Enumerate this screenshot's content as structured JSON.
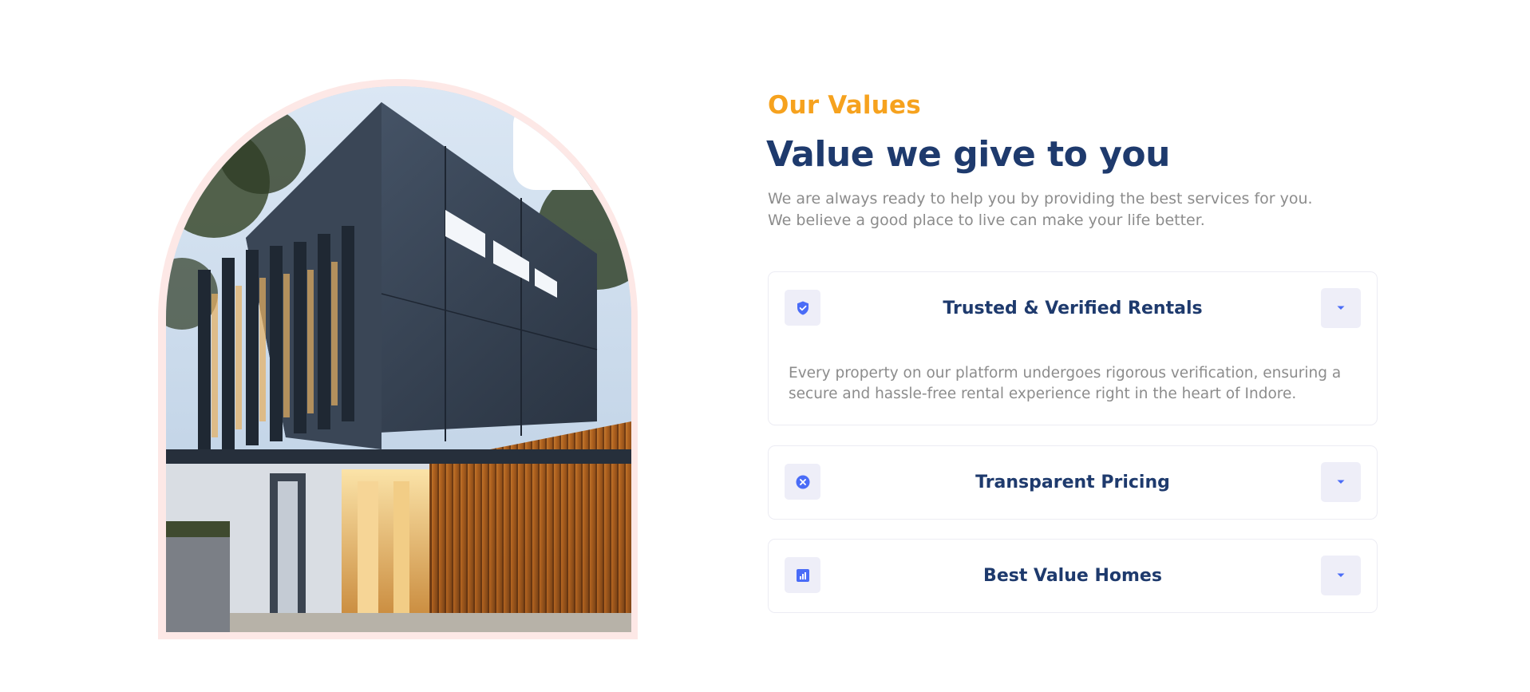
{
  "section": {
    "eyebrow": "Our Values",
    "headline": "Value we give to you",
    "intro_line1": "We are always ready to help you by providing the best services for you.",
    "intro_line2": "We believe a good place to live can make your life better."
  },
  "accordion": [
    {
      "title": "Trusted & Verified Rentals",
      "icon": "shield-check-icon",
      "expanded": true,
      "body_line1": "Every property on our platform undergoes rigorous verification, ensuring a",
      "body_line2": "secure and hassle-free rental experience right in the heart of Indore."
    },
    {
      "title": "Transparent Pricing",
      "icon": "x-circle-icon",
      "expanded": false
    },
    {
      "title": "Best Value Homes",
      "icon": "bar-chart-icon",
      "expanded": false
    }
  ],
  "colors": {
    "accent": "#f6a21e",
    "heading": "#1e3a6d",
    "icon": "#4a6cf7",
    "icon_bg": "#eeeef8",
    "arch_frame": "#fde8e6",
    "muted_text": "#8c8c8c"
  },
  "image": {
    "subject": "modern-house-photo"
  }
}
